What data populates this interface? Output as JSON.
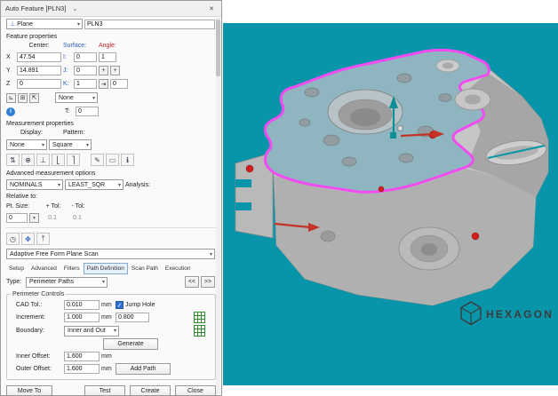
{
  "icons": {
    "close": "✕",
    "chevron": "▾",
    "chevron_small": "⌄",
    "plane": "⊥",
    "plus": "+",
    "tab": "⇥",
    "info": "i",
    "check": "✓",
    "funnel": "▼",
    "toggle1": "⊾",
    "toggle2": "⊞",
    "toggle3": "⇱",
    "toolbar": [
      "⇅",
      "⊕",
      "⊥",
      "⎣",
      "⎤",
      "✎",
      "▭",
      "ℹ"
    ],
    "history": "◷",
    "jog": "✥",
    "insert": "⤒"
  },
  "dialog": {
    "title": "Auto Feature [PLN3]",
    "feature_type": "Plane",
    "feature_name": "PLN3",
    "sections": {
      "feature_properties": "Feature properties",
      "measurement_properties": "Measurement properties",
      "advanced_options": "Advanced measurement options"
    },
    "fp": {
      "center": "Center:",
      "surface": "Surface:",
      "angle": "Angle:",
      "x": "X",
      "x_val": "47.54",
      "y": "Y",
      "y_val": "14.891",
      "z": "Z",
      "z_val": "0",
      "i": "I:",
      "i_val": "0",
      "j": "J:",
      "j_val": "0",
      "k": "K:",
      "k_val": "1",
      "angle_val": "1",
      "angle_val2": "0",
      "workplane_val": "None",
      "t": "T:",
      "t_val": "0"
    },
    "mp": {
      "display": "Display:",
      "display_val": "None",
      "pattern": "Pattern:",
      "pattern_val": "Square"
    },
    "adv": {
      "nominals": "NOMINALS",
      "least_sqr": "LEAST_SQR",
      "analysis": "Analysis:",
      "relative_to": "Relative to:",
      "pt_size": "Pt. Size:",
      "pt_size_val": "0",
      "plus_tol": "+ Tol:",
      "plus_tol_val": "0.1",
      "minus_tol": "- Tol:",
      "minus_tol_val": "0.1"
    },
    "scan": {
      "strategy": "Adaptive Free Form Plane Scan",
      "tabs": [
        "Setup",
        "Advanced",
        "Filters",
        "Path Definition",
        "Scan Path",
        "Execution"
      ],
      "type_label": "Type:",
      "type_val": "Perimeter Paths",
      "prev": "<<",
      "next": ">>",
      "perimeter_controls": "Perimeter Controls",
      "cad_tol": "CAD Tol.:",
      "cad_tol_val": "0.010",
      "mm": "mm",
      "jump_hole": "Jump Hole",
      "increment": "Increment:",
      "increment_val": "1.000",
      "increment_val2": "0.800",
      "boundary": "Boundary:",
      "boundary_val": "Inner and Out",
      "generate": "Generate",
      "inner_offset": "Inner Offset:",
      "inner_offset_val": "1.600",
      "outer_offset": "Outer Offset:",
      "outer_offset_val": "1.600",
      "add_path": "Add Path"
    },
    "footer": {
      "move_to": "Move To",
      "test": "Test",
      "create": "Create",
      "close": "Close"
    }
  },
  "viewport": {
    "logo": "HEXAGON",
    "colors": {
      "background": "#0895A9",
      "selected_face": "#8FB6C0",
      "selection_outline": "#F24BF2",
      "measurement_point": "#D11F1F",
      "axis_teal": "#0C8F96",
      "axis_red": "#C23526"
    }
  }
}
